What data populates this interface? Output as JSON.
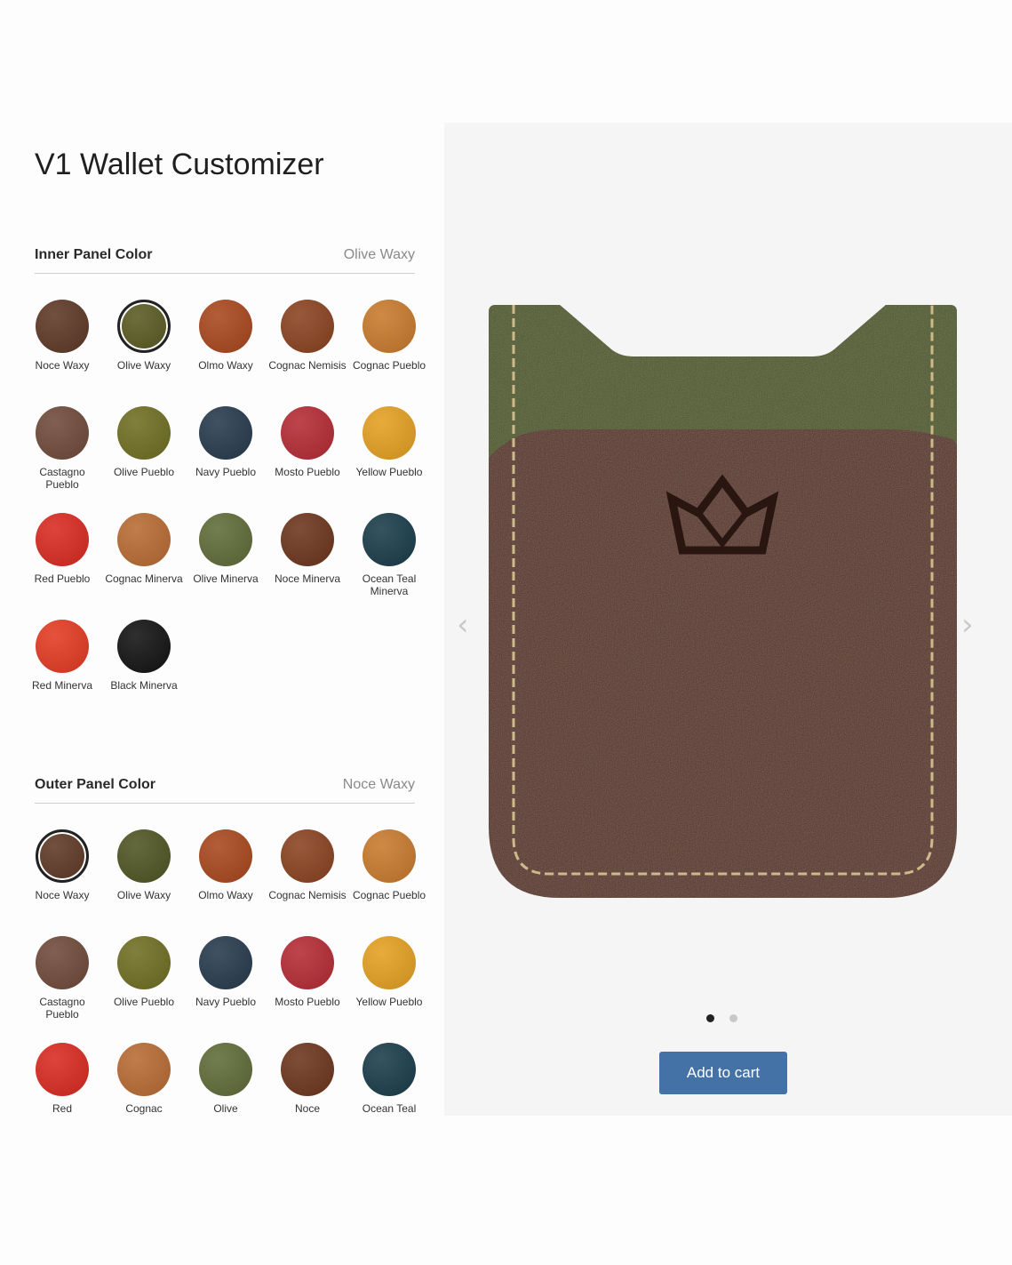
{
  "page": {
    "title": "V1 Wallet Customizer"
  },
  "inner_panel": {
    "label": "Inner Panel Color",
    "selected": "Olive Waxy",
    "swatches": [
      {
        "name": "Noce Waxy",
        "color": "#5e3826"
      },
      {
        "name": "Olive Waxy",
        "color": "#5a5a22"
      },
      {
        "name": "Olmo Waxy",
        "color": "#a8471d"
      },
      {
        "name": "Cognac Nemisis",
        "color": "#8a4220"
      },
      {
        "name": "Cognac Pueblo",
        "color": "#c87a2c"
      },
      {
        "name": "Castagno Pueblo",
        "color": "#6f4a3a"
      },
      {
        "name": "Olive Pueblo",
        "color": "#6f6e22"
      },
      {
        "name": "Navy Pueblo",
        "color": "#263a4d"
      },
      {
        "name": "Mosto Pueblo",
        "color": "#b52a34"
      },
      {
        "name": "Yellow Pueblo",
        "color": "#e4a022"
      },
      {
        "name": "Red Pueblo",
        "color": "#d92a20"
      },
      {
        "name": "Cognac Minerva",
        "color": "#b86b32"
      },
      {
        "name": "Olive Minerva",
        "color": "#5f6b38"
      },
      {
        "name": "Noce Minerva",
        "color": "#6d351c"
      },
      {
        "name": "Ocean Teal Minerva",
        "color": "#193c4a"
      },
      {
        "name": "Red Minerva",
        "color": "#e43a22"
      },
      {
        "name": "Black Minerva",
        "color": "#121212"
      }
    ]
  },
  "outer_panel": {
    "label": "Outer Panel Color",
    "selected": "Noce Waxy",
    "swatches": [
      {
        "name": "Noce Waxy",
        "color": "#5e3826"
      },
      {
        "name": "Olive Waxy",
        "color": "#4e5522"
      },
      {
        "name": "Olmo Waxy",
        "color": "#a8471d"
      },
      {
        "name": "Cognac Nemisis",
        "color": "#8a4220"
      },
      {
        "name": "Cognac Pueblo",
        "color": "#c87a2c"
      },
      {
        "name": "Castagno Pueblo",
        "color": "#6f4a3a"
      },
      {
        "name": "Olive Pueblo",
        "color": "#6f6e22"
      },
      {
        "name": "Navy Pueblo",
        "color": "#263a4d"
      },
      {
        "name": "Mosto Pueblo",
        "color": "#b52a34"
      },
      {
        "name": "Yellow Pueblo",
        "color": "#e4a022"
      },
      {
        "name": "Red",
        "color": "#d92a20"
      },
      {
        "name": "Cognac",
        "color": "#b86b32"
      },
      {
        "name": "Olive",
        "color": "#5f6b38"
      },
      {
        "name": "Noce",
        "color": "#6d351c"
      },
      {
        "name": "Ocean Teal",
        "color": "#193c4a"
      }
    ]
  },
  "preview": {
    "outer_color": "#5a3220",
    "inner_color": "#4f5a22",
    "stitch_color": "#cdb98a",
    "logo_color": "#2a1610",
    "prev_icon": "chevron-left-icon",
    "next_icon": "chevron-right-icon",
    "slide_count": 2,
    "active_slide": 1
  },
  "cart": {
    "label": "Add to cart",
    "color": "#4572a6"
  }
}
